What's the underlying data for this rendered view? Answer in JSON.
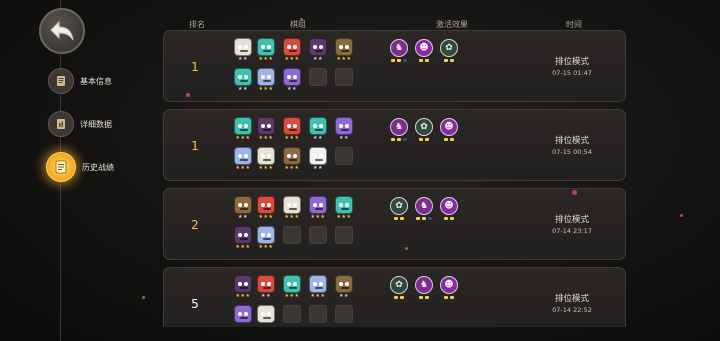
{
  "nav": {
    "items": [
      {
        "label": "基本信息"
      },
      {
        "label": "详细数据"
      },
      {
        "label": "历史战绩"
      }
    ]
  },
  "header": {
    "rank": "排名",
    "pieces": "棋组",
    "synergies": "激活效果",
    "time": "时间"
  },
  "colors": {
    "gold": "#f4c542",
    "purple_synergy": "#7b2d8c",
    "green_synergy": "#2f4a3a",
    "accent": "#f2a51b"
  },
  "matches": [
    {
      "rank": "1",
      "mode": "排位模式",
      "time": "07-15 01:47",
      "pieces": [
        {
          "icon": "white-skull",
          "stars": "★★"
        },
        {
          "icon": "teal-robot",
          "stars": "★★★"
        },
        {
          "icon": "red-vampire",
          "stars": "★★★"
        },
        {
          "icon": "dark-demon",
          "stars": "★★"
        },
        {
          "icon": "brown-beast",
          "stars": "★★★"
        },
        {
          "icon": "teal-robot",
          "stars": "★★"
        },
        {
          "icon": "blue-knight",
          "stars": "★★★"
        },
        {
          "icon": "purple-mage",
          "stars": "★★"
        }
      ],
      "empty_slots": 2,
      "synergies": [
        {
          "icon": "knight-icon",
          "bars": [
            1,
            1,
            0
          ]
        },
        {
          "icon": "demon-icon",
          "bars": [
            1,
            1
          ]
        },
        {
          "icon": "tree-icon",
          "bars": [
            1,
            1
          ]
        }
      ]
    },
    {
      "rank": "1",
      "mode": "排位模式",
      "time": "07-15 00:54",
      "pieces": [
        {
          "icon": "teal-robot",
          "stars": "★★★"
        },
        {
          "icon": "dark-demon",
          "stars": "★★★"
        },
        {
          "icon": "red-vampire",
          "stars": "★★★"
        },
        {
          "icon": "teal-robot",
          "stars": "★★"
        },
        {
          "icon": "purple-mage",
          "stars": "★★"
        },
        {
          "icon": "blue-knight",
          "stars": "★★★"
        },
        {
          "icon": "white-skull",
          "stars": "★★★"
        },
        {
          "icon": "brown-beast",
          "stars": "★★★"
        },
        {
          "icon": "white-yeti",
          "stars": "★★"
        }
      ],
      "empty_slots": 1,
      "synergies": [
        {
          "icon": "knight-icon",
          "bars": [
            1,
            1,
            0
          ]
        },
        {
          "icon": "tree-icon",
          "bars": [
            1,
            1
          ]
        },
        {
          "icon": "demon-icon",
          "bars": [
            1,
            1
          ]
        }
      ]
    },
    {
      "rank": "2",
      "mode": "排位模式",
      "time": "07-14 23:17",
      "pieces": [
        {
          "icon": "brown-beast",
          "stars": "★★"
        },
        {
          "icon": "red-vampire",
          "stars": "★★★"
        },
        {
          "icon": "white-skull",
          "stars": "★★★"
        },
        {
          "icon": "purple-mage",
          "stars": "★★★"
        },
        {
          "icon": "teal-robot",
          "stars": "★★★"
        },
        {
          "icon": "dark-demon",
          "stars": "★★★"
        },
        {
          "icon": "blue-knight",
          "stars": "★★★"
        }
      ],
      "empty_slots": 3,
      "synergies": [
        {
          "icon": "tree-icon",
          "bars": [
            1,
            1
          ]
        },
        {
          "icon": "knight-icon",
          "bars": [
            1,
            1,
            0
          ]
        },
        {
          "icon": "demon-icon",
          "bars": [
            1,
            1
          ]
        }
      ]
    },
    {
      "rank": "5",
      "mode": "排位模式",
      "time": "07-14 22:52",
      "pieces": [
        {
          "icon": "dark-demon",
          "stars": "★★★"
        },
        {
          "icon": "red-vampire",
          "stars": "★★"
        },
        {
          "icon": "teal-robot",
          "stars": "★★★"
        },
        {
          "icon": "blue-knight",
          "stars": "★★★"
        },
        {
          "icon": "brown-beast",
          "stars": "★★"
        },
        {
          "icon": "purple-mage",
          "stars": ""
        },
        {
          "icon": "white-skull",
          "stars": ""
        }
      ],
      "empty_slots": 3,
      "synergies": [
        {
          "icon": "tree-icon",
          "bars": [
            1,
            1
          ]
        },
        {
          "icon": "knight-icon",
          "bars": [
            1,
            1
          ]
        },
        {
          "icon": "demon-icon",
          "bars": [
            1,
            1
          ]
        }
      ]
    }
  ]
}
